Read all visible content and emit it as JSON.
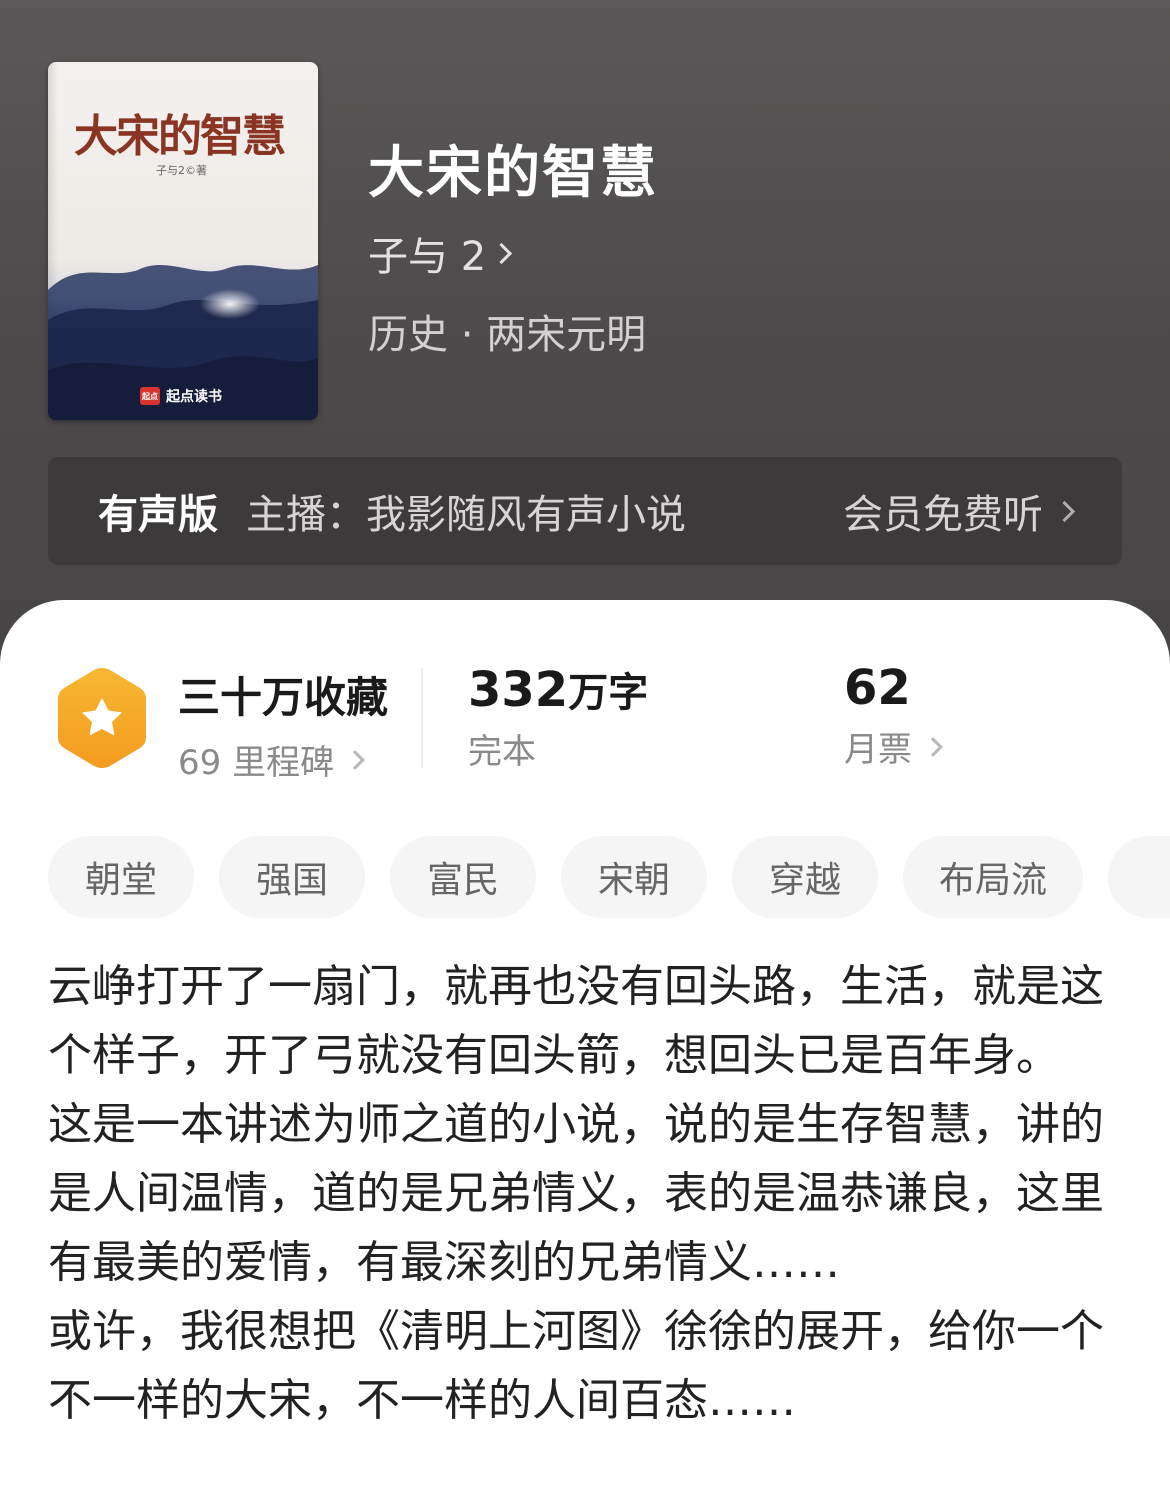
{
  "book": {
    "title": "大宋的智慧",
    "author": "子与 2",
    "genre": "历史 · 两宋元明",
    "cover": {
      "title": "大宋的智慧",
      "author": "子与2©著",
      "publisher": "起点读书",
      "publisher_logo": "起点"
    }
  },
  "audio": {
    "label": "有声版",
    "narrator": "主播：我影随风有声小说",
    "action": "会员免费听"
  },
  "stats": {
    "collections": "三十万收藏",
    "milestones": "69 里程碑",
    "word_count_number": "332",
    "word_count_unit": "万字",
    "status": "完本",
    "monthly_tickets": "62",
    "monthly_tickets_label": "月票"
  },
  "tags": [
    "朝堂",
    "强国",
    "富民",
    "宋朝",
    "穿越",
    "布局流",
    ""
  ],
  "description": [
    "云峥打开了一扇门，就再也没有回头路，生活，就是这个样子，开了弓就没有回头箭，想回头已是百年身。",
    "这是一本讲述为师之道的小说，说的是生存智慧，讲的是人间温情，道的是兄弟情义，表的是温恭谦良，这里有最美的爱情，有最深刻的兄弟情义……",
    "或许，我很想把《清明上河图》徐徐的展开，给你一个不一样的大宋，不一样的人间百态……"
  ],
  "colors": {
    "header_bg": "#4e4b4c",
    "audio_bar_bg": "#3d3a3b",
    "badge_orange": "#f5a623",
    "tag_bg": "#f5f5f5",
    "cover_title": "#8a3524"
  }
}
